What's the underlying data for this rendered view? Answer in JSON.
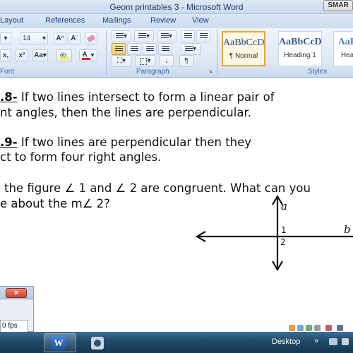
{
  "window": {
    "title": "Geom printables 3 - Microsoft Word",
    "smart_label": "SMAR"
  },
  "tabs": [
    "Layout",
    "References",
    "Mailings",
    "Review",
    "View"
  ],
  "ribbon": {
    "font_size": "14",
    "font_group_label": "Font",
    "paragraph_group_label": "Paragraph",
    "styles_group_label": "Styles",
    "styles": [
      {
        "sample": "AaBbCcD",
        "name": "¶ Normal",
        "selected": true
      },
      {
        "sample": "AaBbCcD",
        "name": "Heading 1",
        "selected": false
      },
      {
        "sample": "AaB",
        "name": "Hea",
        "selected": false
      }
    ]
  },
  "document": {
    "p8_num": ".8-",
    "p8_line1": " If two lines intersect to form a linear pair of",
    "p8_line2": "nt angles, then the lines are perpendicular.",
    "p9_num": ".9-",
    "p9_line1": " If two lines are perpendicular then they",
    "p9_line2": "ct to form four right angles.",
    "q_line1": "the figure ∠ 1 and ∠ 2 are congruent.  What can you",
    "q_line2": "e about the m∠ 2?",
    "figure_labels": {
      "a": "a",
      "b": "b",
      "angle1": "1",
      "angle2": "2"
    }
  },
  "dialog": {
    "fps_value": "0 fps"
  },
  "taskbar": {
    "desktop_label": "Desktop"
  }
}
